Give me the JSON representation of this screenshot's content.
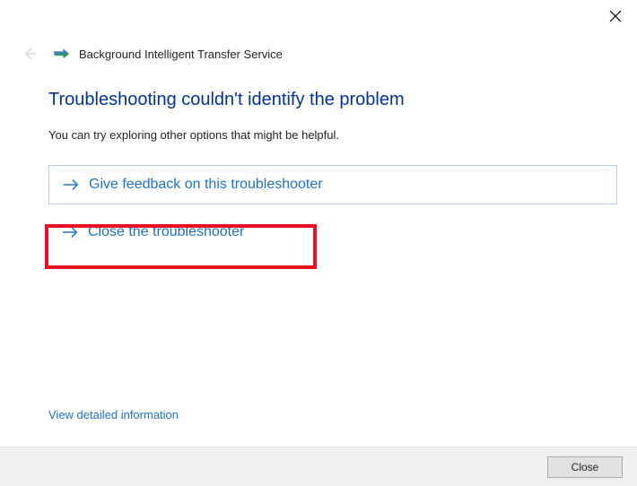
{
  "header": {
    "title": "Background Intelligent Transfer Service"
  },
  "main": {
    "heading": "Troubleshooting couldn't identify the problem",
    "subtext": "You can try exploring other options that might be helpful.",
    "options": {
      "feedback": "Give feedback on this troubleshooter",
      "close": "Close the troubleshooter"
    },
    "detail_link": "View detailed information"
  },
  "footer": {
    "close_label": "Close"
  },
  "colors": {
    "heading_blue": "#003399",
    "link_blue": "#1a73c7",
    "highlight_red": "#e81123"
  }
}
